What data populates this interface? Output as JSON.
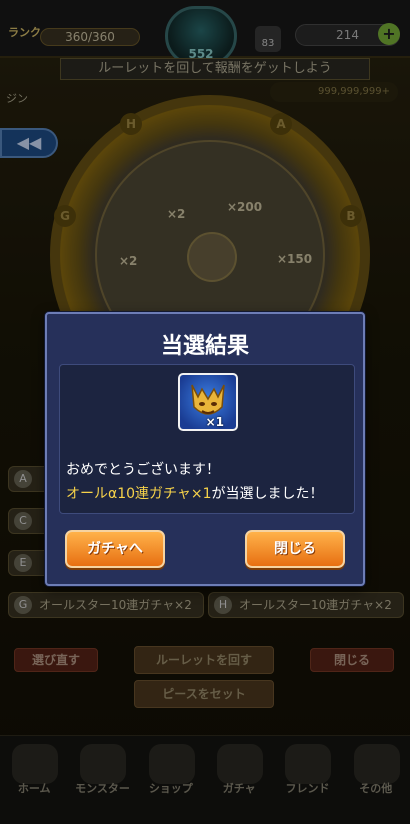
{
  "header": {
    "rank_label": "ランク",
    "stamina": "360/360",
    "level": "552",
    "badge": "83",
    "orbs": "214",
    "plus": "+"
  },
  "banner": "ルーレットを回して報酬をゲットしよう",
  "user": {
    "name": "ジン",
    "coins": "999,999,999+"
  },
  "back_label": "◀◀",
  "wheel": {
    "letters": [
      "H",
      "A",
      "G",
      "B"
    ],
    "segments": [
      "×2",
      "×200",
      "×2",
      "×150"
    ]
  },
  "prizes": [
    {
      "letter": "A",
      "text": ""
    },
    {
      "letter": "C",
      "text": ""
    },
    {
      "letter": "E",
      "text": ""
    },
    {
      "letter": "G",
      "text": "オールスター10連ガチャ×2"
    },
    {
      "letter": "H",
      "text": "オールスター10連ガチャ×2"
    }
  ],
  "bg_buttons": {
    "reselect": "選び直す",
    "spin": "ルーレットを回す",
    "close": "閉じる",
    "set_piece": "ピースをセット"
  },
  "nav": [
    "ホーム",
    "モンスター",
    "ショップ",
    "ガチャ",
    "フレンド",
    "その他"
  ],
  "dialog": {
    "title": "当選結果",
    "item_count": "×1",
    "message_1": "おめでとうございます！",
    "message_2_highlight": "オールα10連ガチャ×1",
    "message_2_rest": "が当選しました！",
    "gacha_button": "ガチャへ",
    "close_button": "閉じる"
  }
}
